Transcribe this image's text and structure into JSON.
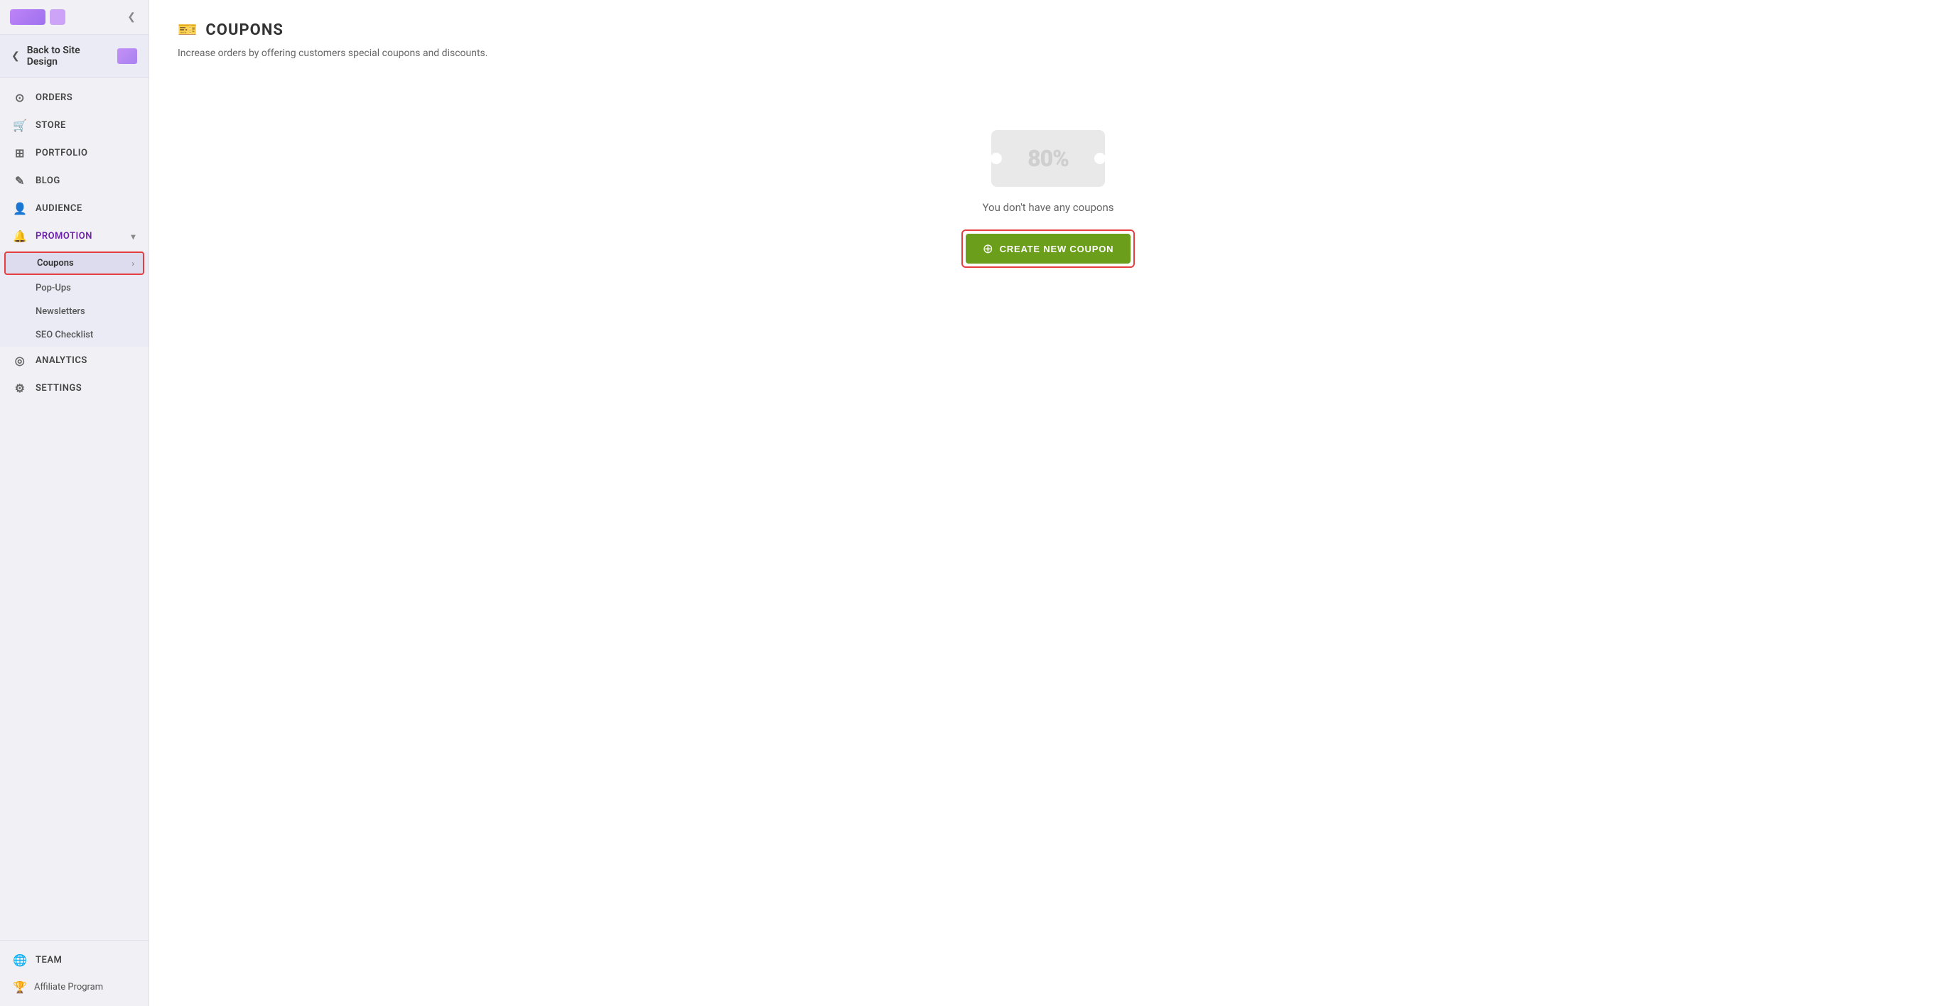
{
  "sidebar": {
    "collapse_label": "❮",
    "back_button": {
      "label": "Back to Site Design",
      "arrow": "❮"
    },
    "nav_items": [
      {
        "id": "orders",
        "label": "ORDERS",
        "icon": "⊙"
      },
      {
        "id": "store",
        "label": "STORE",
        "icon": "☐"
      },
      {
        "id": "portfolio",
        "label": "PORTFOLIO",
        "icon": "⊞"
      },
      {
        "id": "blog",
        "label": "BLOG",
        "icon": "✎"
      },
      {
        "id": "audience",
        "label": "AUDIENCE",
        "icon": "♟"
      },
      {
        "id": "promotion",
        "label": "PROMOTION",
        "icon": "🔔",
        "expanded": true
      }
    ],
    "promotion_sub_items": [
      {
        "id": "coupons",
        "label": "Coupons",
        "active": true
      },
      {
        "id": "popups",
        "label": "Pop-Ups"
      },
      {
        "id": "newsletters",
        "label": "Newsletters"
      },
      {
        "id": "seo_checklist",
        "label": "SEO Checklist"
      }
    ],
    "bottom_items": [
      {
        "id": "analytics",
        "label": "ANALYTICS",
        "icon": "⊙"
      },
      {
        "id": "settings",
        "label": "SETTINGS",
        "icon": "⚙"
      },
      {
        "id": "team",
        "label": "TEAM",
        "icon": "🌐"
      }
    ],
    "affiliate": {
      "label": "Affiliate Program",
      "icon": "🏆"
    }
  },
  "main": {
    "page_icon": "🎫",
    "page_title": "COUPONS",
    "page_subtitle": "Increase orders by offering customers special coupons and discounts.",
    "empty_state": {
      "coupon_label": "80%",
      "empty_text": "You don't have any coupons",
      "create_button_label": "CREATE NEW COUPON",
      "create_button_icon": "⊕"
    }
  }
}
